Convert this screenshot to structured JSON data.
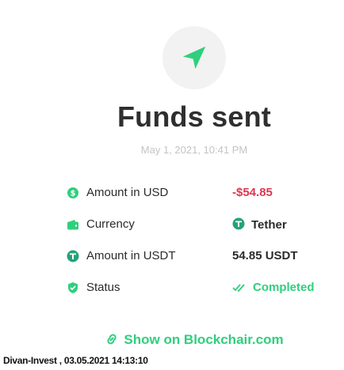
{
  "header": {
    "icon": "send-icon",
    "title": "Funds sent",
    "date": "May 1, 2021, 10:41 PM"
  },
  "details": [
    {
      "icon": "dollar-icon",
      "label": "Amount in USD",
      "value": "-$54.85"
    },
    {
      "icon": "wallet-icon",
      "label": "Currency",
      "value": "Tether",
      "value_icon": "tether-icon"
    },
    {
      "icon": "tether-icon",
      "label": "Amount in USDT",
      "value": "54.85 USDT"
    },
    {
      "icon": "shield-icon",
      "label": "Status",
      "value": "Completed",
      "value_icon": "double-check-icon"
    }
  ],
  "link": {
    "label": "Show on Blockchair.com",
    "icon": "link-icon"
  },
  "footer": {
    "text": "Divan-Invest  ,  03.05.2021 14:13:10"
  },
  "colors": {
    "accent": "#2fcf7d",
    "negative": "#e0364f",
    "text": "#2b2b2b",
    "muted": "#c4c4c4"
  }
}
